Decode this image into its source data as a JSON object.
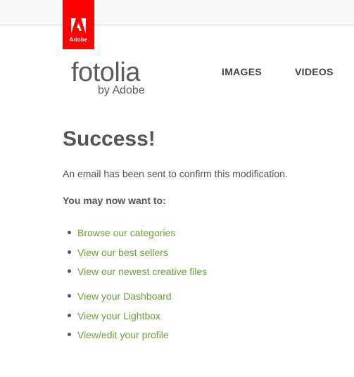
{
  "header": {
    "badge_text": "Adobe",
    "logo_main": "fotolia",
    "logo_sub": "by Adobe",
    "nav": [
      {
        "label": "IMAGES"
      },
      {
        "label": "VIDEOS"
      }
    ]
  },
  "main": {
    "title": "Success!",
    "message": "An email has been sent to confirm this modification.",
    "next_heading": "You may now want to:",
    "links_group1": [
      {
        "label": "Browse our categories"
      },
      {
        "label": "View our best sellers"
      },
      {
        "label": "View our newest creative files"
      }
    ],
    "links_group2": [
      {
        "label": "View your Dashboard"
      },
      {
        "label": "View your Lightbox"
      },
      {
        "label": "View/edit your profile"
      }
    ]
  },
  "colors": {
    "badge": "#ff0000",
    "link": "#6ca13b",
    "text": "#555555"
  }
}
